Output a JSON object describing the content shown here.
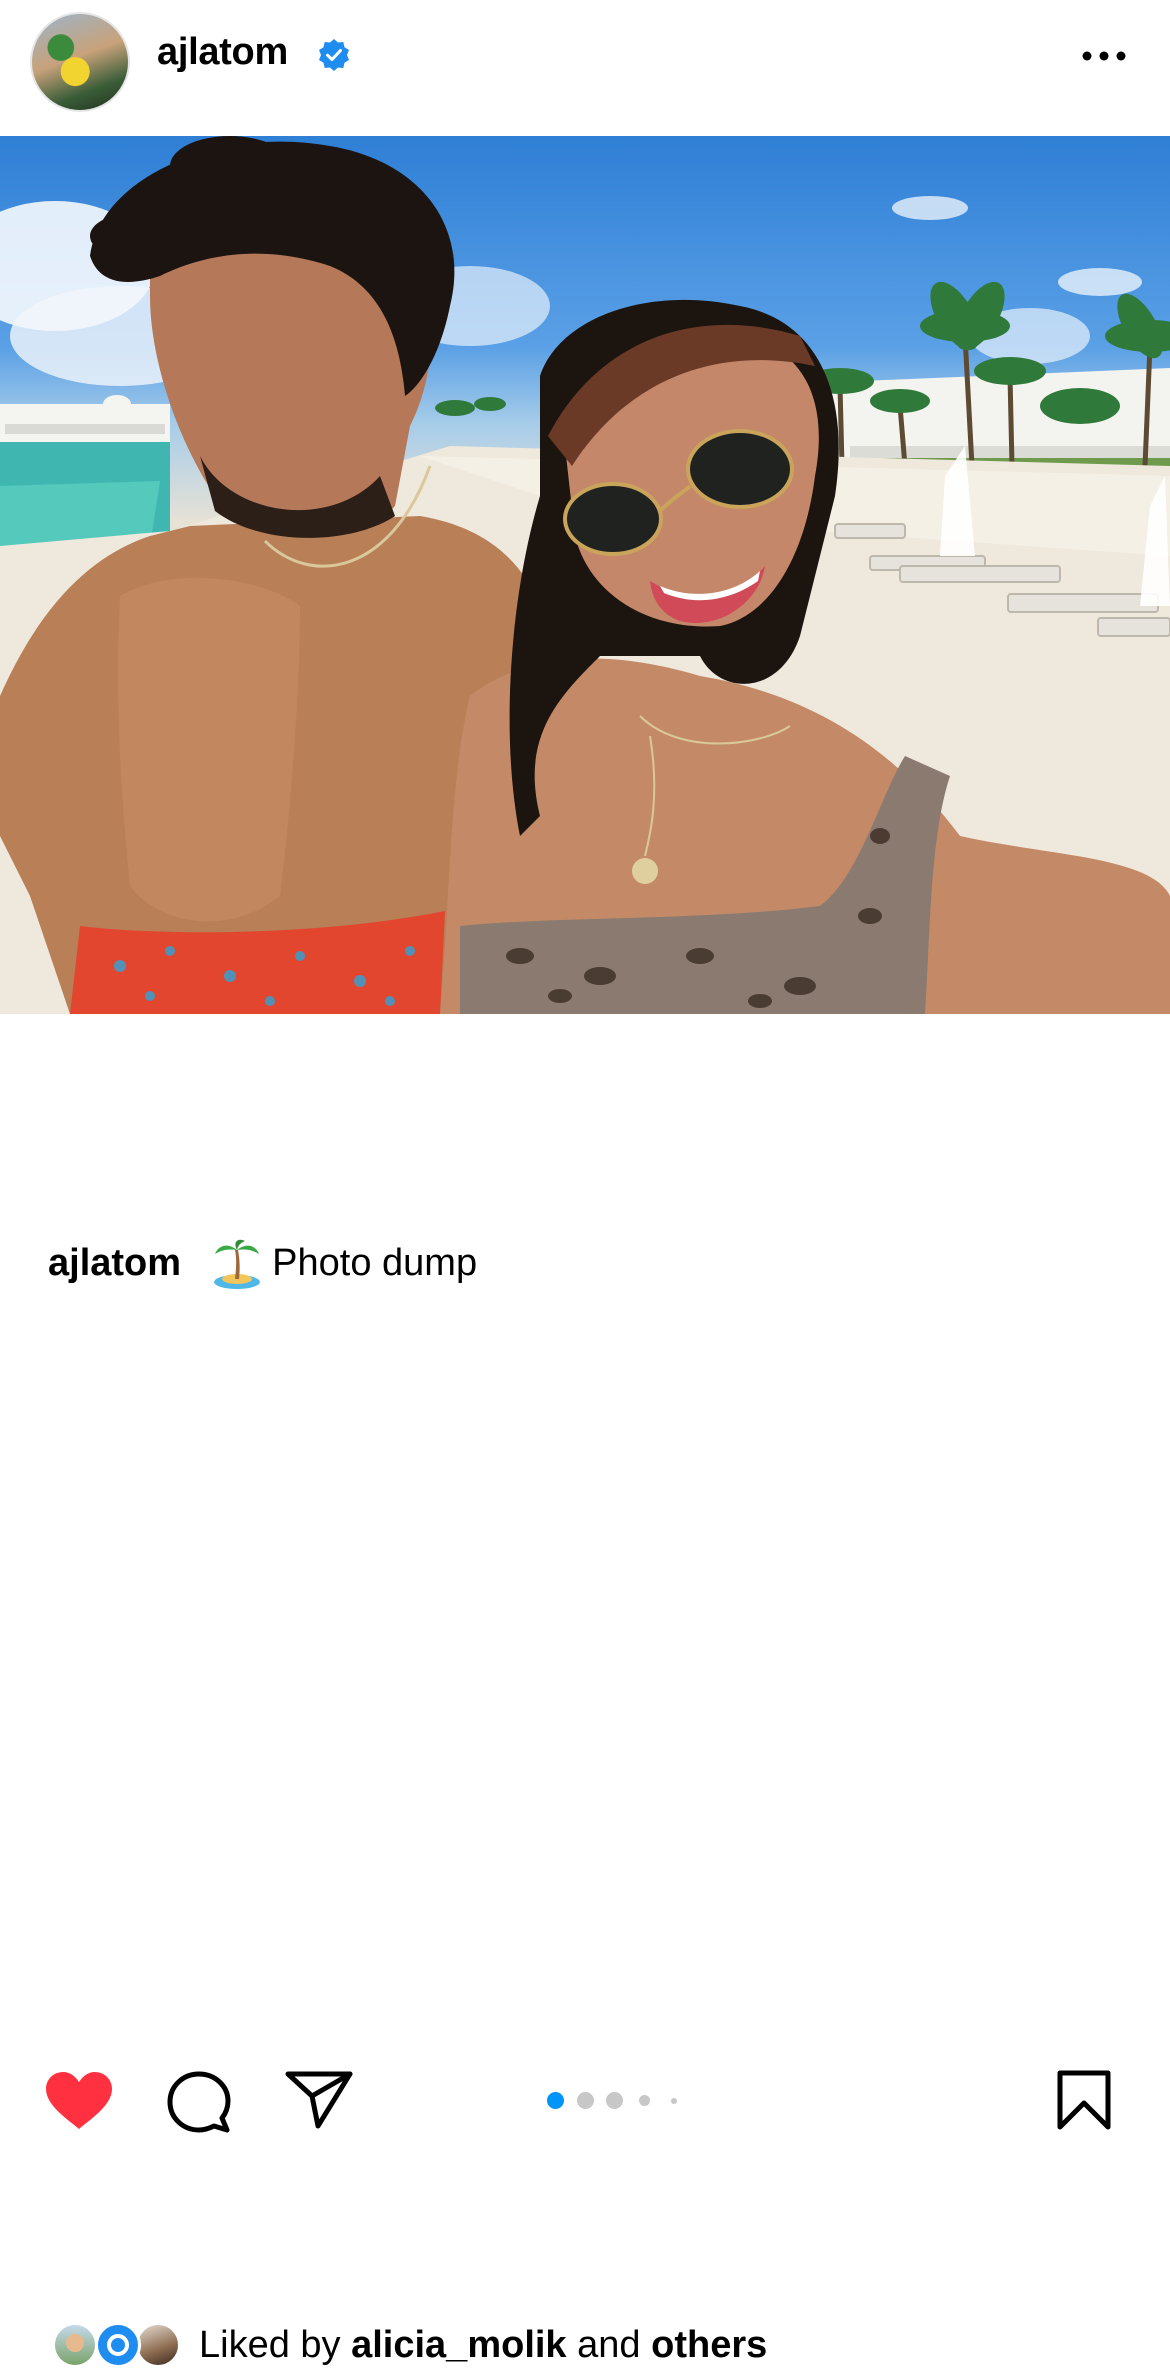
{
  "post": {
    "username": "ajlatom",
    "verified": true,
    "more_icon": "more-horizontal-icon",
    "carousel": {
      "total": 5,
      "active_index": 0
    },
    "actions": {
      "like_icon": "heart-filled-icon",
      "comment_icon": "comment-bubble-icon",
      "share_icon": "paper-plane-icon",
      "save_icon": "bookmark-icon"
    },
    "likes": {
      "prefix": "Liked by",
      "user": "alicia_molik",
      "joiner": "and",
      "others": "others"
    },
    "caption": {
      "username": "ajlatom",
      "emoji": "palm-island-emoji",
      "text": "Photo dump"
    },
    "colors": {
      "like_red": "#ff3040",
      "active_dot": "#0095f6",
      "inactive_dot": "#c7c7c7",
      "verified_blue": "#1f8cf0"
    }
  }
}
